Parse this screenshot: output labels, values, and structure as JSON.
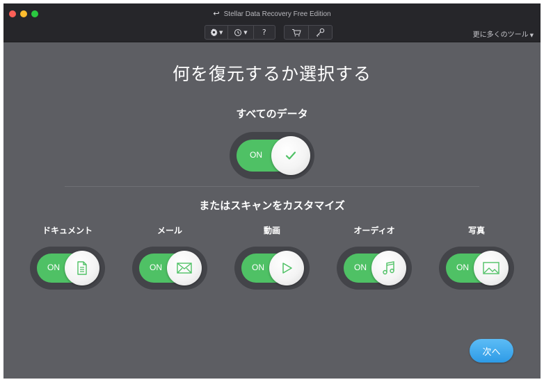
{
  "window": {
    "title": "Stellar Data Recovery Free Edition"
  },
  "toolbar": {
    "settings_icon": "gear-icon",
    "history_icon": "history-icon",
    "help_label": "?",
    "cart_icon": "cart-icon",
    "key_icon": "key-icon",
    "more_tools_label": "更に多くのツール"
  },
  "main": {
    "heading": "何を復元するか選択する",
    "all_data_label": "すべてのデータ",
    "all_data_toggle": {
      "state_label": "ON",
      "icon": "check-icon",
      "on": true
    },
    "customize_label": "またはスキャンをカスタマイズ",
    "categories": [
      {
        "label": "ドキュメント",
        "state_label": "ON",
        "icon": "document-icon",
        "on": true
      },
      {
        "label": "メール",
        "state_label": "ON",
        "icon": "mail-icon",
        "on": true
      },
      {
        "label": "動画",
        "state_label": "ON",
        "icon": "video-icon",
        "on": true
      },
      {
        "label": "オーディオ",
        "state_label": "ON",
        "icon": "audio-icon",
        "on": true
      },
      {
        "label": "写真",
        "state_label": "ON",
        "icon": "photo-icon",
        "on": true
      }
    ],
    "next_label": "次へ"
  },
  "colors": {
    "background": "#5d5e63",
    "toggle_on": "#4fc165",
    "icon_green": "#4fc165",
    "next_button": "#3aa6ee"
  }
}
